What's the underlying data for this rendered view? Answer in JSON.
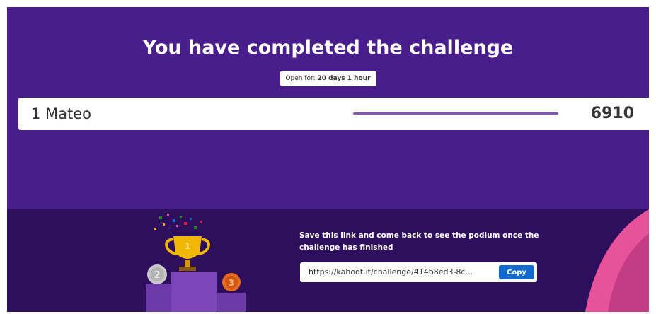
{
  "header": {
    "title": "You have completed the challenge",
    "open_for_label": "Open for:",
    "open_for_value": "20 days 1 hour"
  },
  "leaderboard": [
    {
      "rank": "1",
      "name": "Mateo",
      "label": "1 Mateo",
      "score": "6910",
      "bar_fraction": 1.0
    }
  ],
  "podium": {
    "first_place_label": "1",
    "second_place_label": "2",
    "third_place_label": "3"
  },
  "share": {
    "message": "Save this link and come back to see the podium once the challenge has finished",
    "link_value": "https://kahoot.it/challenge/414b8ed3-8c...",
    "copy_label": "Copy"
  },
  "colors": {
    "background": "#4a1d8c",
    "bottom_band": "#2e0f5e",
    "score_bar": "#8a54b8",
    "copy_button": "#1368ce",
    "accent_pink": "#e8529a"
  }
}
